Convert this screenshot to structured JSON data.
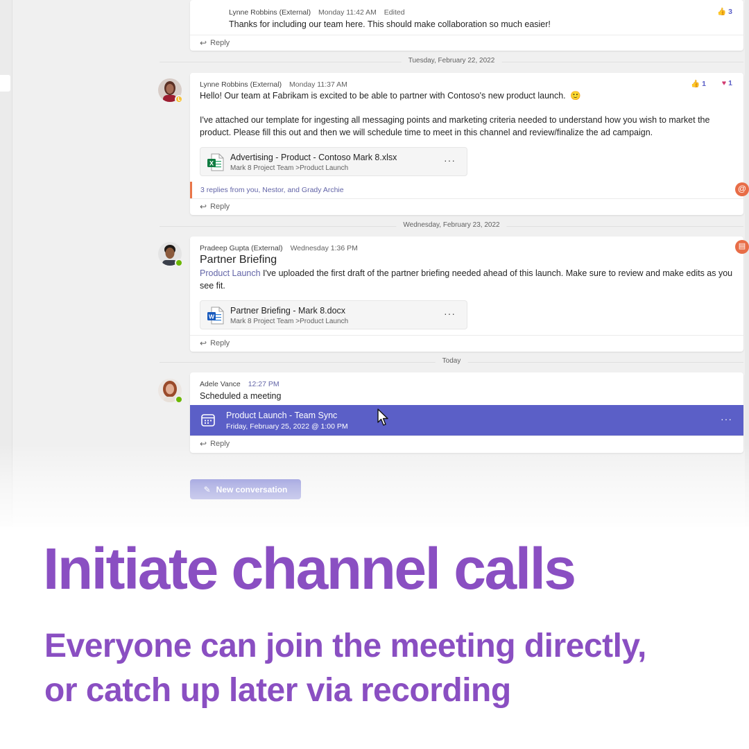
{
  "messages": [
    {
      "author": "Lynne Robbins (External)",
      "time": "Monday 11:42 AM",
      "edited": "Edited",
      "text": "Thanks for including our team here. This should make collaboration so much easier!",
      "reactions": [
        {
          "icon": "like-icon",
          "count": "3"
        }
      ],
      "reply_label": "Reply"
    },
    {
      "date_divider": "Tuesday, February 22, 2022",
      "author": "Lynne Robbins (External)",
      "time": "Monday 11:37 AM",
      "text_line1": "Hello! Our team at Fabrikam is excited to be able to partner with Contoso's new product launch.",
      "text_para2_line1": "I've attached our template for ingesting all messaging points and marketing criteria needed to understand how you wish to market the",
      "text_para2_line2": "product. Please fill this out and then we will schedule time to meet in this channel and review/finalize the ad campaign.",
      "reactions": [
        {
          "icon": "like-icon",
          "count": "1"
        },
        {
          "icon": "heart-icon",
          "count": "1"
        }
      ],
      "attachment": {
        "name": "Advertising - Product - Contoso Mark 8.xlsx",
        "path": "Mark 8 Project Team >Product Launch",
        "type": "excel"
      },
      "thread_replies": "3 replies from you, Nestor, and Grady Archie",
      "reply_label": "Reply"
    },
    {
      "date_divider": "Wednesday, February 23, 2022",
      "author": "Pradeep Gupta (External)",
      "time": "Wednesday 1:36 PM",
      "subject": "Partner Briefing",
      "tag": "Product Launch",
      "text_line1": " I've uploaded the first draft of the partner briefing needed ahead of this launch. Make sure to review and make edits as you",
      "text_line2": "see fit.",
      "attachment": {
        "name": "Partner Briefing - Mark 8.docx",
        "path": "Mark 8 Project Team >Product Launch",
        "type": "word"
      },
      "reply_label": "Reply"
    },
    {
      "date_divider": "Today",
      "author": "Adele Vance",
      "time": "12:27 PM",
      "text": "Scheduled a meeting",
      "meeting": {
        "title": "Product Launch - Team Sync",
        "datetime": "Friday, February 25, 2022 @ 1:00 PM"
      },
      "reply_label": "Reply"
    }
  ],
  "new_conversation_label": "New conversation",
  "headline": "Initiate channel calls",
  "subhead_line1": "Everyone can join the meeting directly,",
  "subhead_line2": "or catch up later via recording",
  "colors": {
    "accent": "#5b5fc7",
    "headline": "#8a4fc2",
    "mention": "#e86d47",
    "presence_available": "#6bb700",
    "presence_away": "#f8c135"
  }
}
